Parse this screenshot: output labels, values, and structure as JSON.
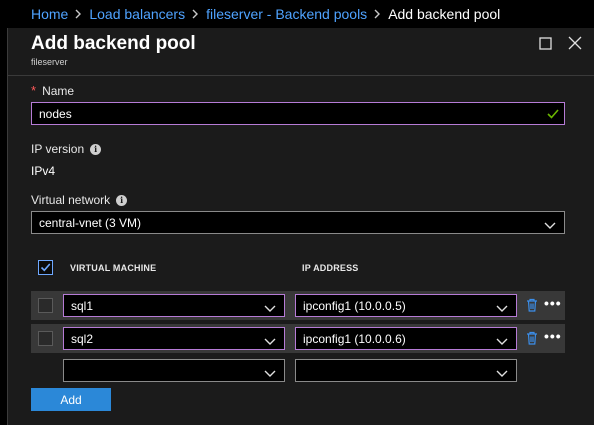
{
  "breadcrumb": {
    "items": [
      "Home",
      "Load balancers",
      "fileserver - Backend pools"
    ],
    "current": "Add backend pool"
  },
  "blade": {
    "title": "Add backend pool",
    "subtitle": "fileserver"
  },
  "form": {
    "name_label": "Name",
    "name_required_marker": "*",
    "name_value": "nodes",
    "ip_version_label": "IP version",
    "ip_version_value": "IPv4",
    "vnet_label": "Virtual network",
    "vnet_value": "central-vnet (3 VM)"
  },
  "table": {
    "col_vm": "VIRTUAL MACHINE",
    "col_ip": "IP ADDRESS",
    "rows": [
      {
        "vm": "sql1",
        "ip": "ipconfig1 (10.0.0.5)"
      },
      {
        "vm": "sql2",
        "ip": "ipconfig1 (10.0.0.6)"
      }
    ],
    "more_glyph": "•••"
  },
  "actions": {
    "add_label": "Add"
  },
  "icons": {
    "info": "info-icon",
    "check": "check-icon",
    "chevron": "chevron-down-icon",
    "delete": "trash-icon",
    "more": "more-icon",
    "maximize": "maximize-icon",
    "close": "close-icon"
  },
  "colors": {
    "accent_link": "#4fa3ff",
    "focus_border": "#b67bd6",
    "primary_button": "#2b88d8",
    "valid_check": "#6bb700",
    "required": "#ff5a5a",
    "delete_icon": "#3b8eea"
  }
}
